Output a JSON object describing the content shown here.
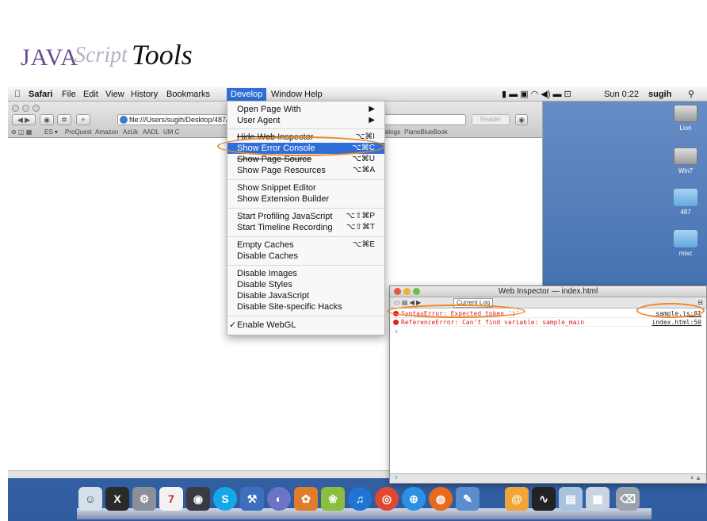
{
  "header": {
    "logo_java": "JAVA",
    "logo_script": "Script",
    "logo_tools": "Tools"
  },
  "menubar": {
    "apple_icon": "apple-icon",
    "items": [
      "Safari",
      "File",
      "Edit",
      "View",
      "History",
      "Bookmarks",
      "Develop",
      "Window",
      "Help"
    ],
    "selected": "Develop",
    "clock": "Sun 0:22",
    "user": "sugih"
  },
  "safari": {
    "url": "file:///Users/sugih/Desktop/487/",
    "reader": "Reader",
    "bookmarks": [
      "ES ▾",
      "ProQuest",
      "Amazon",
      "AzUk",
      "AADL",
      "UM C",
      "Ratings",
      "PianoBlueBook"
    ]
  },
  "develop_menu": {
    "items": [
      {
        "label": "Open Page With",
        "shortcut": "▶"
      },
      {
        "label": "User Agent",
        "shortcut": "▶"
      },
      {
        "label": "Hide Web Inspector",
        "shortcut": "⌥⌘I"
      },
      {
        "label": "Show Error Console",
        "shortcut": "⌥⌘C"
      },
      {
        "label": "Show Page Source",
        "shortcut": "⌥⌘U"
      },
      {
        "label": "Show Page Resources",
        "shortcut": "⌥⌘A"
      },
      {
        "label": "Show Snippet Editor",
        "shortcut": ""
      },
      {
        "label": "Show Extension Builder",
        "shortcut": ""
      },
      {
        "label": "Start Profiling JavaScript",
        "shortcut": "⌥⇧⌘P"
      },
      {
        "label": "Start Timeline Recording",
        "shortcut": "⌥⇧⌘T"
      },
      {
        "label": "Empty Caches",
        "shortcut": "⌥⌘E"
      },
      {
        "label": "Disable Caches",
        "shortcut": ""
      },
      {
        "label": "Disable Images",
        "shortcut": ""
      },
      {
        "label": "Disable Styles",
        "shortcut": ""
      },
      {
        "label": "Disable JavaScript",
        "shortcut": ""
      },
      {
        "label": "Disable Site-specific Hacks",
        "shortcut": ""
      },
      {
        "label": "Enable WebGL",
        "shortcut": ""
      }
    ],
    "checked": "✓"
  },
  "inspector": {
    "title": "Web Inspector — index.html",
    "scope": "Current Log",
    "logs": [
      {
        "message": "SyntaxError: Expected token ')'",
        "source": "sample.js:81"
      },
      {
        "message": "ReferenceError: Can't find variable: sample_main",
        "source": "index.html:50"
      }
    ],
    "prompt": "›"
  },
  "desktop_icons": [
    "Lion",
    "Win7",
    "487",
    "misc"
  ],
  "colors": {
    "highlight": "#2f6ed8",
    "annotation": "#ee8722",
    "error": "#d22222"
  }
}
